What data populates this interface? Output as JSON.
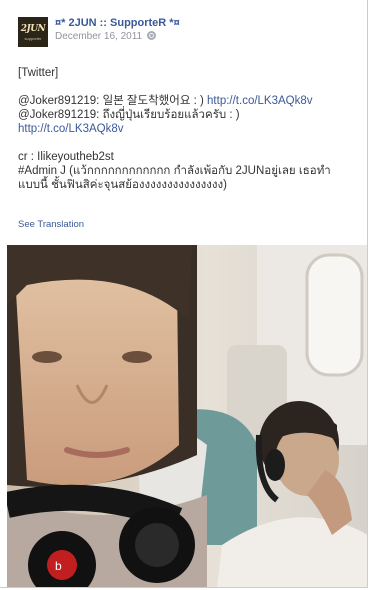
{
  "post": {
    "author": "¤* 2JUN :: SupporteR *¤",
    "date": "December 16, 2011",
    "privacy_icon": "globe-icon",
    "avatar_text": "2JUN",
    "avatar_subtext": "supporter",
    "lines": {
      "tag": "[Twitter]",
      "handle1": "@Joker891219:",
      "text1": "일본 잘도착했어요 : )",
      "link1": "http://t.co/LK3AQk8v",
      "handle2": "@Joker891219:",
      "text2": "ถึงญี่ปุ่นเรียบร้อยแล้วครับ : )",
      "link2": "http://t.co/LK3AQk8v",
      "credit": "cr : Ilikeyoutheb2st",
      "admin_line1": "#Admin J (แว้กกกกกกกกกกกก กำลังเพ้อกับ 2JUNอยู่เลย เธอทำ",
      "admin_line2": "แบบนี้ ชั้นฟินสิค่ะจุนสย้องงงงงงงงงงงงงงง)"
    },
    "see_translation": "See Translation",
    "photo_description_icon": "airplane-selfie-photo"
  }
}
